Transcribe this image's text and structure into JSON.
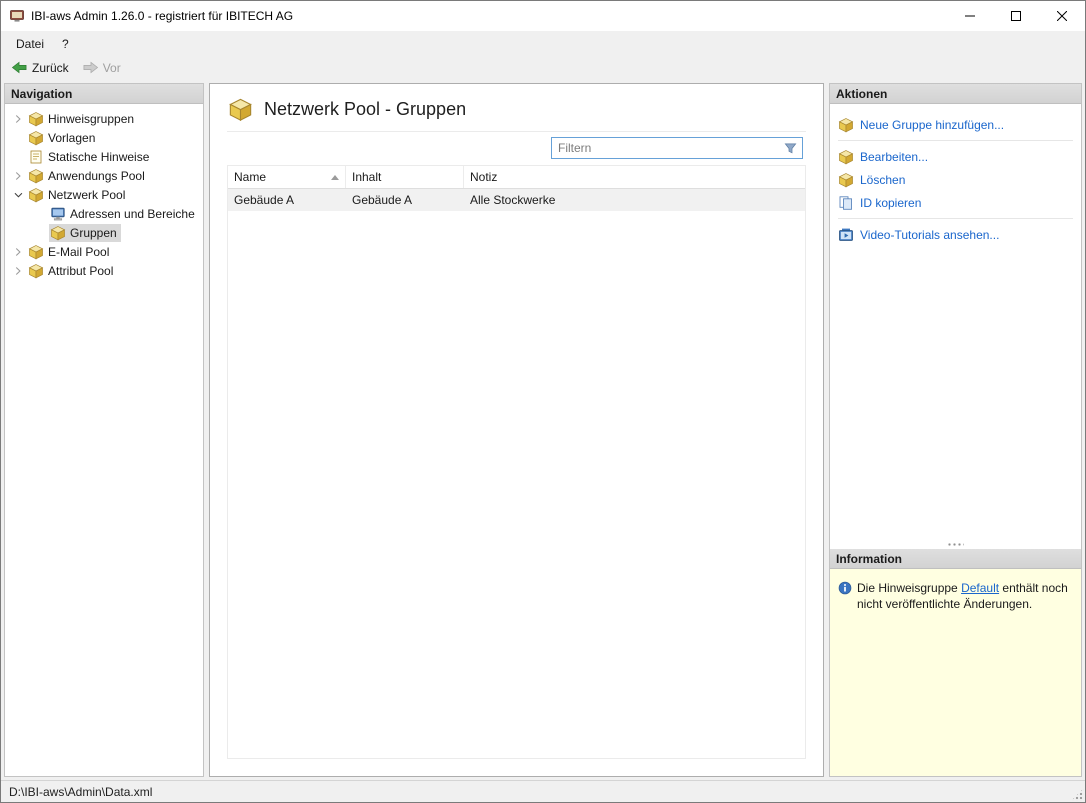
{
  "window": {
    "title": "IBI-aws Admin 1.26.0 - registriert für IBITECH AG"
  },
  "menubar": {
    "items": [
      {
        "label": "Datei"
      },
      {
        "label": "?"
      }
    ]
  },
  "toolbar": {
    "back": {
      "label": "Zurück",
      "enabled": true,
      "icon": "back-arrow-icon"
    },
    "forward": {
      "label": "Vor",
      "enabled": false,
      "icon": "forward-arrow-icon"
    }
  },
  "navigation": {
    "header": "Navigation",
    "items": [
      {
        "label": "Hinweisgruppen",
        "level": 0,
        "state": "collapsed",
        "icon": "package-icon",
        "selected": false
      },
      {
        "label": "Vorlagen",
        "level": 0,
        "state": "leaf",
        "icon": "package-icon",
        "selected": false
      },
      {
        "label": "Statische Hinweise",
        "level": 0,
        "state": "leaf",
        "icon": "note-icon",
        "selected": false
      },
      {
        "label": "Anwendungs Pool",
        "level": 0,
        "state": "collapsed",
        "icon": "package-icon",
        "selected": false
      },
      {
        "label": "Netzwerk Pool",
        "level": 0,
        "state": "expanded",
        "icon": "package-icon",
        "selected": false
      },
      {
        "label": "Adressen und Bereiche",
        "level": 1,
        "state": "leaf",
        "icon": "network-computer-icon",
        "selected": false
      },
      {
        "label": "Gruppen",
        "level": 1,
        "state": "leaf",
        "icon": "package-icon",
        "selected": true
      },
      {
        "label": "E-Mail Pool",
        "level": 0,
        "state": "collapsed",
        "icon": "package-icon",
        "selected": false
      },
      {
        "label": "Attribut Pool",
        "level": 0,
        "state": "collapsed",
        "icon": "package-icon",
        "selected": false
      }
    ]
  },
  "main": {
    "title": "Netzwerk Pool - Gruppen",
    "title_icon": "package-icon",
    "filter": {
      "placeholder": "Filtern",
      "value": "",
      "icon": "filter-funnel-icon"
    },
    "table": {
      "columns": [
        {
          "label": "Name",
          "sort": "asc"
        },
        {
          "label": "Inhalt",
          "sort": "none"
        },
        {
          "label": "Notiz",
          "sort": "none"
        }
      ],
      "rows": [
        {
          "name": "Gebäude A",
          "inhalt": "Gebäude A",
          "notiz": "Alle Stockwerke"
        }
      ]
    }
  },
  "actions": {
    "header": "Aktionen",
    "items": [
      {
        "label": "Neue Gruppe hinzufügen...",
        "icon": "package-add-icon"
      },
      {
        "label": "Bearbeiten...",
        "icon": "package-edit-icon"
      },
      {
        "label": "Löschen",
        "icon": "package-delete-icon"
      },
      {
        "label": "ID kopieren",
        "icon": "copy-icon"
      },
      {
        "label": "Video-Tutorials ansehen...",
        "icon": "video-icon"
      }
    ]
  },
  "information": {
    "header": "Information",
    "icon": "info-icon",
    "text_before": "Die Hinweisgruppe ",
    "link_label": "Default",
    "text_after": " enthält noch nicht veröffentlichte Änderungen."
  },
  "statusbar": {
    "path": "D:\\IBI-aws\\Admin\\Data.xml"
  }
}
